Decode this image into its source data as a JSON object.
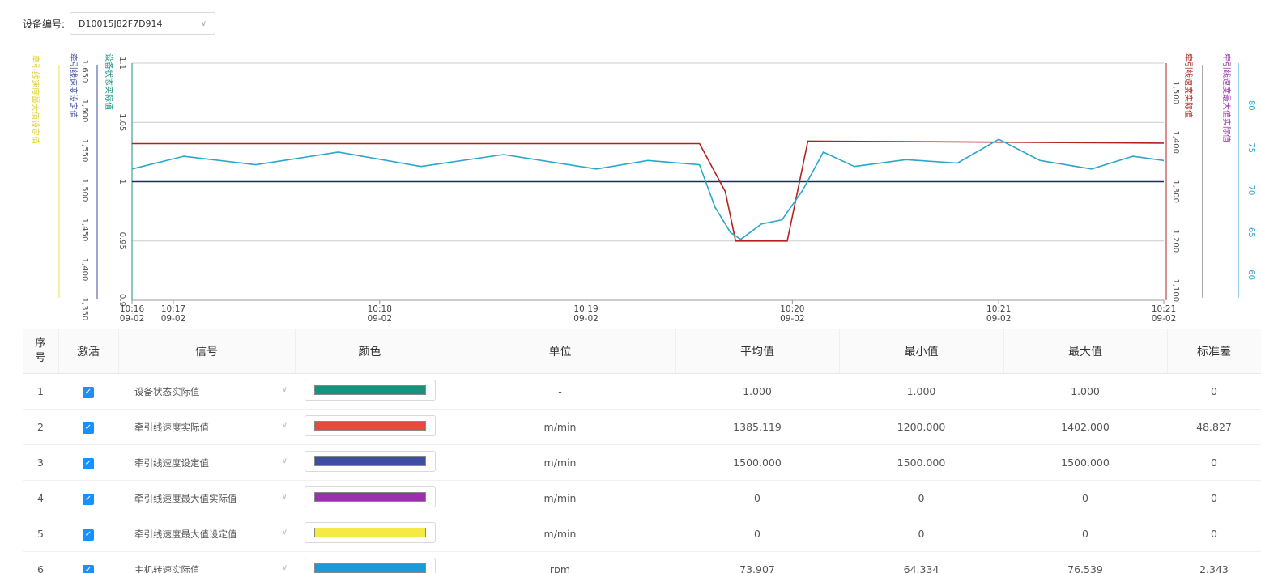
{
  "toolbar": {
    "device_label": "设备编号:",
    "device_value": "D10015J82F7D914"
  },
  "chart_data": {
    "type": "line",
    "x_ticks": [
      {
        "time": "10:16",
        "date": "09-02"
      },
      {
        "time": "10:17",
        "date": "09-02"
      },
      {
        "time": "10:18",
        "date": "09-02"
      },
      {
        "time": "10:19",
        "date": "09-02"
      },
      {
        "time": "10:20",
        "date": "09-02"
      },
      {
        "time": "10:21",
        "date": "09-02"
      },
      {
        "time": "10:21",
        "date": "09-02"
      }
    ],
    "axes": {
      "yellow_axis_label": "牵引线速度最大值设定值",
      "blue_axis_label": "牵引线速度设定值",
      "blue_axis_ticks": [
        "1,650",
        "1,600",
        "1,550",
        "1,500",
        "1,450",
        "1,400",
        "1,350"
      ],
      "green_axis_label": "设备状态实际值",
      "green_axis_ticks": [
        "1.1",
        "1.05",
        "1",
        "0.95",
        "0.9"
      ],
      "red_axis_label": "牵引线速度实际值",
      "red_axis_ticks": [
        "1,500",
        "1,400",
        "1,300",
        "1,200",
        "1,100"
      ],
      "purple_axis_label": "牵引线速度最大值实际值",
      "cyan_axis_ticks": [
        "80",
        "75",
        "70",
        "65",
        "60"
      ]
    },
    "series": [
      {
        "name": "设备状态实际值",
        "color": "#1a2a6c",
        "constant": 1.0
      },
      {
        "name": "牵引线速度实际值",
        "color": "#b22222",
        "points": [
          [
            0,
            1397
          ],
          [
            0.55,
            1397
          ],
          [
            0.575,
            1300
          ],
          [
            0.585,
            1200
          ],
          [
            0.635,
            1200
          ],
          [
            0.645,
            1300
          ],
          [
            0.655,
            1402
          ],
          [
            1,
            1398
          ]
        ]
      },
      {
        "name": "主机转速实际值",
        "color": "#2aa7c9",
        "points": [
          [
            0,
            72.5
          ],
          [
            0.05,
            74
          ],
          [
            0.12,
            73
          ],
          [
            0.2,
            74.5
          ],
          [
            0.28,
            72.8
          ],
          [
            0.36,
            74.2
          ],
          [
            0.45,
            72.5
          ],
          [
            0.5,
            73.5
          ],
          [
            0.55,
            73
          ],
          [
            0.565,
            68
          ],
          [
            0.58,
            65
          ],
          [
            0.59,
            64.2
          ],
          [
            0.61,
            66
          ],
          [
            0.63,
            66.5
          ],
          [
            0.65,
            70
          ],
          [
            0.67,
            74.5
          ],
          [
            0.7,
            72.8
          ],
          [
            0.75,
            73.6
          ],
          [
            0.8,
            73.2
          ],
          [
            0.84,
            76
          ],
          [
            0.88,
            73.5
          ],
          [
            0.93,
            72.5
          ],
          [
            0.97,
            74
          ],
          [
            1,
            73.5
          ]
        ]
      }
    ]
  },
  "table": {
    "headers": [
      "序号",
      "激活",
      "信号",
      "颜色",
      "单位",
      "平均值",
      "最小值",
      "最大值",
      "标准差"
    ],
    "rows": [
      {
        "no": "1",
        "signal": "设备状态实际值",
        "color": "#16937c",
        "unit": "-",
        "avg": "1.000",
        "min": "1.000",
        "max": "1.000",
        "std": "0"
      },
      {
        "no": "2",
        "signal": "牵引线速度实际值",
        "color": "#e8493f",
        "unit": "m/min",
        "avg": "1385.119",
        "min": "1200.000",
        "max": "1402.000",
        "std": "48.827"
      },
      {
        "no": "3",
        "signal": "牵引线速度设定值",
        "color": "#3e4ea0",
        "unit": "m/min",
        "avg": "1500.000",
        "min": "1500.000",
        "max": "1500.000",
        "std": "0"
      },
      {
        "no": "4",
        "signal": "牵引线速度最大值实际值",
        "color": "#9b2fae",
        "unit": "m/min",
        "avg": "0",
        "min": "0",
        "max": "0",
        "std": "0"
      },
      {
        "no": "5",
        "signal": "牵引线速度最大值设定值",
        "color": "#f5e946",
        "unit": "m/min",
        "avg": "0",
        "min": "0",
        "max": "0",
        "std": "0"
      },
      {
        "no": "6",
        "signal": "主机转速实际值",
        "color": "#1a9bd7",
        "unit": "rpm",
        "avg": "73.907",
        "min": "64.334",
        "max": "76.539",
        "std": "2.343"
      }
    ]
  },
  "icons": {
    "checkbox": "check-icon",
    "dropdown": "chevron-down-icon"
  }
}
